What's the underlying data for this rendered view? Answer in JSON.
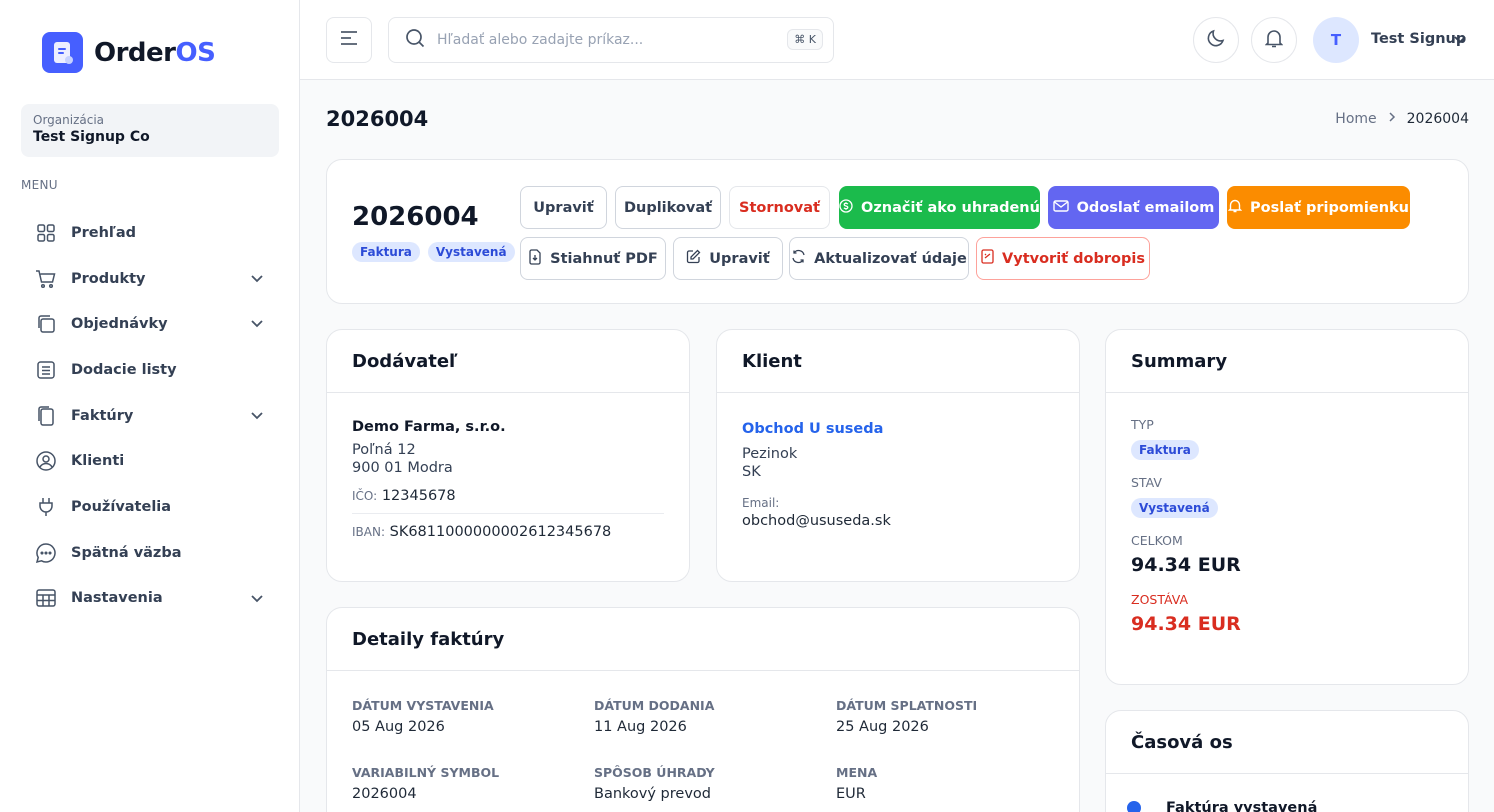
{
  "app": {
    "logo_text_a": "Order",
    "logo_text_b": "OS",
    "brand_color": "#465fff"
  },
  "sidebar": {
    "org_label": "Organizácia",
    "org_name": "Test Signup Co",
    "menu_label": "MENU",
    "items": [
      {
        "label": "Prehľad",
        "icon": "grid-icon",
        "has_chevron": false
      },
      {
        "label": "Produkty",
        "icon": "cart-icon",
        "has_chevron": true
      },
      {
        "label": "Objednávky",
        "icon": "copy-icon",
        "has_chevron": true
      },
      {
        "label": "Dodacie listy",
        "icon": "list-icon",
        "has_chevron": false
      },
      {
        "label": "Faktúry",
        "icon": "document-icon",
        "has_chevron": true
      },
      {
        "label": "Klienti",
        "icon": "user-circle-icon",
        "has_chevron": false
      },
      {
        "label": "Používatelia",
        "icon": "plug-icon",
        "has_chevron": false
      },
      {
        "label": "Spätná väzba",
        "icon": "chat-icon",
        "has_chevron": false
      },
      {
        "label": "Nastavenia",
        "icon": "table-icon",
        "has_chevron": true
      }
    ]
  },
  "header": {
    "search_placeholder": "Hľadať alebo zadajte príkaz...",
    "search_shortcut": "⌘ K",
    "user_initial": "T",
    "user_name": "Test Signup"
  },
  "page": {
    "title": "2026004",
    "breadcrumb_home": "Home",
    "breadcrumb_current": "2026004"
  },
  "invoice": {
    "number": "2026004",
    "badge_type": "Faktura",
    "badge_status": "Vystavená",
    "actions": {
      "edit": "Upraviť",
      "duplicate": "Duplikovať",
      "cancel": "Stornovať",
      "mark_paid": "Označiť ako uhradenú",
      "send_email": "Odoslať emailom",
      "send_reminder": "Poslať pripomienku",
      "download_pdf": "Stiahnuť PDF",
      "edit2": "Upraviť",
      "refresh": "Aktualizovať údaje",
      "credit_note": "Vytvoriť dobropis"
    }
  },
  "supplier": {
    "title": "Dodávateľ",
    "name": "Demo Farma, s.r.o.",
    "street": "Poľná 12",
    "city": "900 01 Modra",
    "ico_label": "IČO:",
    "ico": "12345678",
    "iban_label": "IBAN:",
    "iban": "SK6811000000002612345678"
  },
  "client": {
    "title": "Klient",
    "name": "Obchod U suseda",
    "city": "Pezinok",
    "country": "SK",
    "email_label": "Email:",
    "email": "obchod@ususeda.sk"
  },
  "summary": {
    "title": "Summary",
    "type_label": "TYP",
    "type_value": "Faktura",
    "status_label": "STAV",
    "status_value": "Vystavená",
    "total_label": "CELKOM",
    "total_value": "94.34 EUR",
    "remaining_label": "ZOSTÁVA",
    "remaining_value": "94.34 EUR",
    "remaining_color": "#d92d20"
  },
  "details": {
    "title": "Detaily faktúry",
    "issue_date_label": "DÁTUM VYSTAVENIA",
    "issue_date": "05 Aug 2026",
    "delivery_date_label": "DÁTUM DODANIA",
    "delivery_date": "11 Aug 2026",
    "due_date_label": "DÁTUM SPLATNOSTI",
    "due_date": "25 Aug 2026",
    "vs_label": "VARIABILNÝ SYMBOL",
    "vs": "2026004",
    "payment_label": "SPÔSOB ÚHRADY",
    "payment": "Bankový prevod",
    "currency_label": "MENA",
    "currency": "EUR"
  },
  "timeline": {
    "title": "Časová os",
    "first_event": "Faktúra vystavená"
  }
}
